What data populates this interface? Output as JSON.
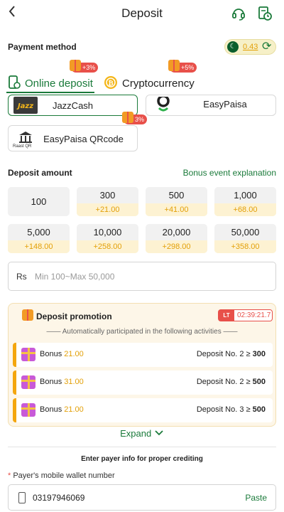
{
  "header": {
    "title": "Deposit",
    "back_icon": "chevron-left-icon",
    "support_icon": "headset-icon",
    "records_icon": "document-clock-icon"
  },
  "payment_method": {
    "label": "Payment method",
    "balance": "0.43",
    "tabs": [
      {
        "label": "Online deposit",
        "badge": "+3%",
        "active": true
      },
      {
        "label": "Cryptocurrency",
        "badge": "+5%",
        "active": false
      }
    ],
    "methods": [
      {
        "label": "JazzCash",
        "badge": ""
      },
      {
        "label": "EasyPaisa",
        "badge": ""
      },
      {
        "label": "EasyPaisa QRcode",
        "badge": "3%",
        "logo_text": "Raast QR"
      }
    ]
  },
  "deposit_amount": {
    "label": "Deposit amount",
    "bonus_link": "Bonus event explanation",
    "options": [
      {
        "value": "100",
        "bonus": ""
      },
      {
        "value": "300",
        "bonus": "+21.00"
      },
      {
        "value": "500",
        "bonus": "+41.00"
      },
      {
        "value": "1,000",
        "bonus": "+68.00"
      },
      {
        "value": "5,000",
        "bonus": "+148.00"
      },
      {
        "value": "10,000",
        "bonus": "+258.00"
      },
      {
        "value": "20,000",
        "bonus": "+298.00"
      },
      {
        "value": "50,000",
        "bonus": "+358.00"
      }
    ],
    "currency": "Rs",
    "placeholder": "Min 100~Max 50,000"
  },
  "promotion": {
    "title": "Deposit promotion",
    "timer_tag": "LT",
    "timer": "02:39:21.7",
    "subtitle": "—— Automatically participated in the following activities ——",
    "rows": [
      {
        "bonus_label": "Bonus",
        "bonus_amount": "21.00",
        "deposit_label": "Deposit No. 2 ≥",
        "deposit_min": "300"
      },
      {
        "bonus_label": "Bonus",
        "bonus_amount": "31.00",
        "deposit_label": "Deposit No. 2 ≥",
        "deposit_min": "500"
      },
      {
        "bonus_label": "Bonus",
        "bonus_amount": "21.00",
        "deposit_label": "Deposit No. 3 ≥",
        "deposit_min": "500"
      }
    ],
    "expand": "Expand"
  },
  "payer": {
    "title": "Enter payer info for proper crediting",
    "wallet_label": "Payer's mobile wallet number",
    "required_mark": "*",
    "phone": "03197946069",
    "paste": "Paste"
  },
  "colors": {
    "accent_green": "#1a7a3a",
    "bonus_gold": "#e3a008",
    "badge_red": "#e8504a"
  }
}
